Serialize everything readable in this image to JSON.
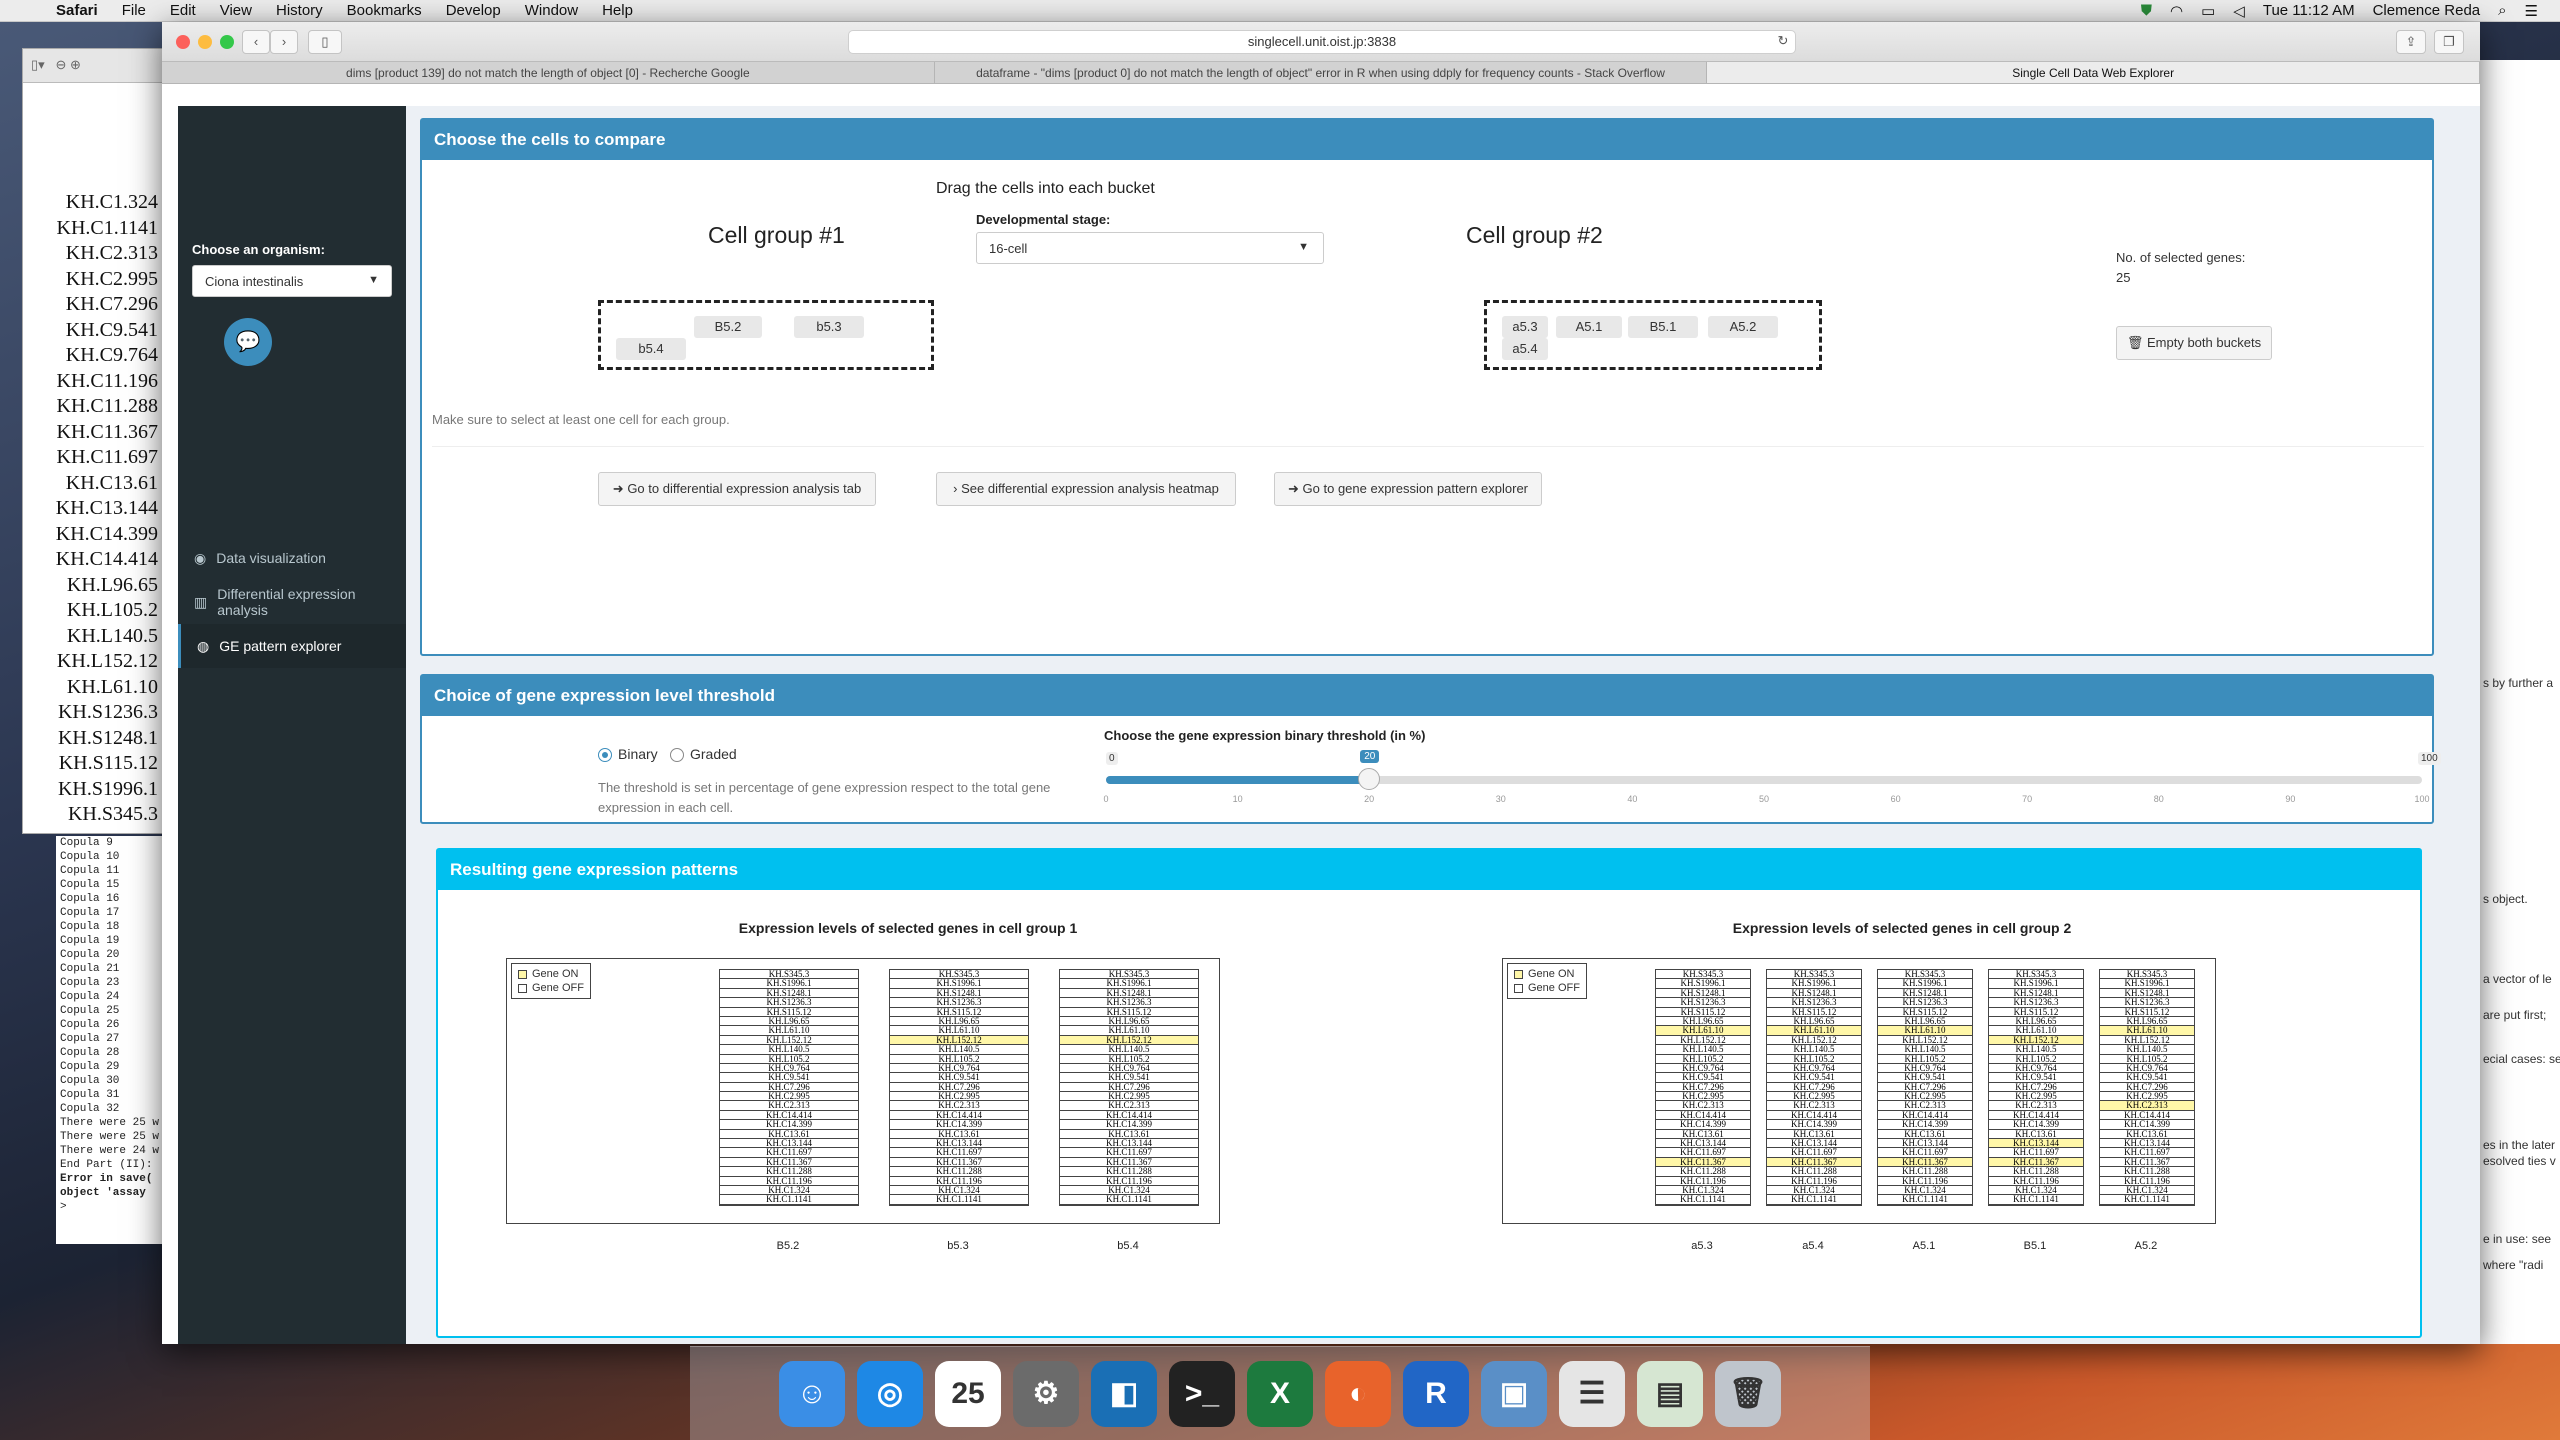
{
  "menubar": {
    "app": "Safari",
    "items": [
      "File",
      "Edit",
      "View",
      "History",
      "Bookmarks",
      "Develop",
      "Window",
      "Help"
    ],
    "clock": "Tue 11:12 AM",
    "user": "Clemence Reda"
  },
  "browser": {
    "url": "singlecell.unit.oist.jp:3838",
    "tabs": [
      "dims [product 139] do not match the length of object [0] - Recherche Google",
      "dataframe - \"dims [product 0] do not match the length of object\" error in R when using ddply for frequency counts - Stack Overflow",
      "Single Cell Data Web Explorer"
    ]
  },
  "sidebar": {
    "organism_label": "Choose an organism:",
    "organism_value": "Ciona intestinalis",
    "menu": [
      {
        "label": "Data visualization",
        "icon": "eye-icon"
      },
      {
        "label": "Differential expression analysis",
        "icon": "bar-chart-icon"
      },
      {
        "label": "GE pattern explorer",
        "icon": "palette-icon"
      }
    ]
  },
  "compare": {
    "title": "Choose the cells to compare",
    "instruction": "Drag the cells into each bucket",
    "stage_label": "Developmental stage:",
    "stage_value": "16-cell",
    "group1_title": "Cell group #1",
    "group2_title": "Cell group #2",
    "group1_cells": [
      "B5.2",
      "b5.3",
      "b5.4"
    ],
    "group2_cells": [
      "a5.3",
      "A5.1",
      "B5.1",
      "A5.2",
      "a5.4"
    ],
    "genes_label": "No. of selected genes:",
    "genes_count": "25",
    "empty_btn": "Empty both buckets",
    "note": "Make sure to select at least one cell for each group.",
    "btn_diff_tab": "Go to differential expression analysis tab",
    "btn_heatmap": "See differential expression analysis heatmap",
    "btn_pattern": "Go to gene expression pattern explorer"
  },
  "threshold": {
    "title": "Choice of gene expression level threshold",
    "radio_binary": "Binary",
    "radio_graded": "Graded",
    "selected": "Binary",
    "note": "The threshold is set in percentage of gene expression respect to the total gene expression in each cell.",
    "slider_label": "Choose the gene expression binary threshold (in %)",
    "min": "0",
    "max": "100",
    "value": "20",
    "value_fraction": 0.2,
    "ticks": [
      "0",
      "10",
      "20",
      "30",
      "40",
      "50",
      "60",
      "70",
      "80",
      "90",
      "100"
    ]
  },
  "results": {
    "title": "Resulting gene expression patterns",
    "plot1_title": "Expression levels of selected genes in cell group 1",
    "plot2_title": "Expression levels of selected genes in cell group 2",
    "legend_on": "Gene ON",
    "legend_off": "Gene OFF",
    "on_color": "#fff7a8",
    "genes": [
      "KH.S345.3",
      "KH.S1996.1",
      "KH.S1248.1",
      "KH.S1236.3",
      "KH.S115.12",
      "KH.L96.65",
      "KH.L61.10",
      "KH.L152.12",
      "KH.L140.5",
      "KH.L105.2",
      "KH.C9.764",
      "KH.C9.541",
      "KH.C7.296",
      "KH.C2.995",
      "KH.C2.313",
      "KH.C14.414",
      "KH.C14.399",
      "KH.C13.61",
      "KH.C13.144",
      "KH.C11.697",
      "KH.C11.367",
      "KH.C11.288",
      "KH.C11.196",
      "KH.C1.324",
      "KH.C1.1141"
    ],
    "group1_cols": [
      {
        "cell": "B5.2",
        "on": []
      },
      {
        "cell": "b5.3",
        "on": [
          "KH.L152.12"
        ]
      },
      {
        "cell": "b5.4",
        "on": [
          "KH.L152.12"
        ]
      }
    ],
    "group2_cols": [
      {
        "cell": "a5.3",
        "on": [
          "KH.L61.10",
          "KH.C11.367"
        ]
      },
      {
        "cell": "a5.4",
        "on": [
          "KH.L61.10",
          "KH.C11.367"
        ]
      },
      {
        "cell": "A5.1",
        "on": [
          "KH.L61.10",
          "KH.C11.367"
        ]
      },
      {
        "cell": "B5.1",
        "on": [
          "KH.L152.12",
          "KH.C13.144",
          "KH.C11.367"
        ]
      },
      {
        "cell": "A5.2",
        "on": [
          "KH.L61.10",
          "KH.C2.313"
        ]
      }
    ]
  },
  "background_window": {
    "genes": [
      "KH.C1.324",
      "KH.C1.1141",
      "KH.C2.313",
      "KH.C2.995",
      "KH.C7.296",
      "KH.C9.541",
      "KH.C9.764",
      "KH.C11.196",
      "KH.C11.288",
      "KH.C11.367",
      "KH.C11.697",
      "KH.C13.61",
      "KH.C13.144",
      "KH.C14.399",
      "KH.C14.414",
      "KH.L96.65",
      "KH.L105.2",
      "KH.L140.5",
      "KH.L152.12",
      "KH.L61.10",
      "KH.S1236.3",
      "KH.S1248.1",
      "KH.S115.12",
      "KH.S1996.1",
      "KH.S345.3"
    ]
  },
  "console": {
    "lines": [
      "Copula 9",
      "Copula 10",
      "Copula 11",
      "Copula 15",
      "Copula 16",
      "Copula 17",
      "Copula 18",
      "Copula 19",
      "Copula 20",
      "Copula 21",
      "Copula 23",
      "Copula 24",
      "Copula 25",
      "Copula 26",
      "Copula 27",
      "Copula 28",
      "Copula 29",
      "Copula 30",
      "Copula 31",
      "Copula 32",
      "There were 25 w",
      "There were 25 w",
      "There were 24 w",
      "End Part (II):",
      "Error in save(",
      "  object 'assay",
      "> "
    ]
  },
  "right_snippets": [
    "s by further a",
    "s object.",
    "a vector of le",
    "are put first;",
    "ecial cases: se",
    "es in the later",
    "esolved ties v",
    "e in use: see",
    "where \"radi"
  ],
  "dock": [
    "Finder",
    "Safari",
    "Calendar",
    "System Preferences",
    "Mirror",
    "Terminal",
    "Excel",
    "Firefox",
    "R",
    "Preview",
    "Document",
    "Spreadsheet",
    "Trash"
  ]
}
